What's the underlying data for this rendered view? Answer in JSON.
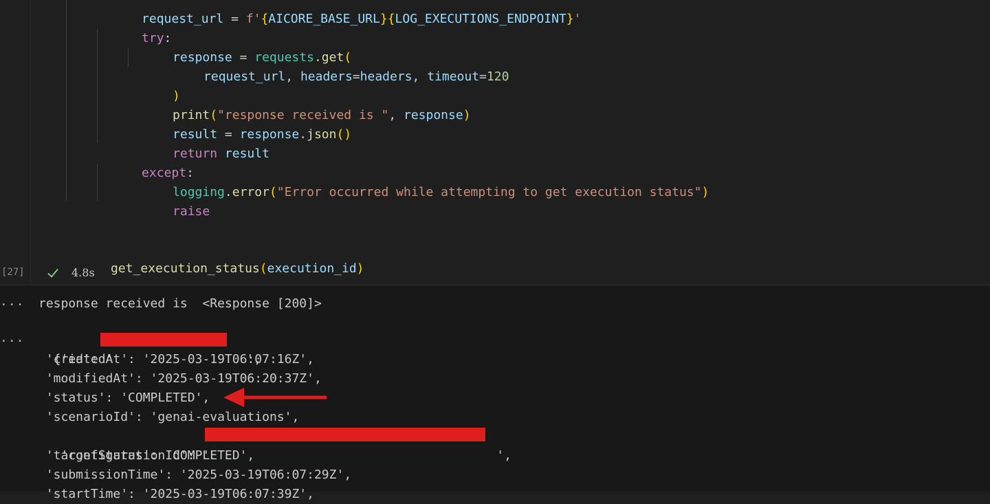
{
  "code": {
    "line_url": {
      "indent": "        ",
      "name": "request_url",
      "op": " = ",
      "fstr_prefix": "f'",
      "brace1": "{",
      "v1": "AICORE_BASE_URL",
      "brace2": "}",
      "brace3": "{",
      "v2": "LOG_EXECUTIONS_ENDPOINT",
      "brace4": "}",
      "tail": "'"
    },
    "line_try": {
      "kw": "try",
      "punct": ":"
    },
    "line_resp": {
      "var": "response",
      "op": " = ",
      "mod": "requests",
      "dot": ".",
      "fn": "get",
      "paren": "("
    },
    "line_args": {
      "a1": "request_url",
      "c1": ", ",
      "a2": "headers",
      "eq1": "=",
      "a3": "headers",
      "c2": ", ",
      "a4": "timeout",
      "eq2": "=",
      "num": "120"
    },
    "line_close": {
      "paren": ")"
    },
    "line_print": {
      "fn": "print",
      "p1": "(",
      "str": "\"response received is \"",
      "c": ", ",
      "var": "response",
      "p2": ")"
    },
    "line_result": {
      "var": "result",
      "op": " = ",
      "obj": "response",
      "dot": ".",
      "fn": "json",
      "p1": "(",
      "p2": ")"
    },
    "line_return": {
      "kw": "return",
      "var": " result"
    },
    "line_except": {
      "kw": "except",
      "punct": ":"
    },
    "line_log": {
      "mod": "logging",
      "dot": ".",
      "fn": "error",
      "p1": "(",
      "str": "\"Error occurred while attempting to get execution status\"",
      "p2": ")"
    },
    "line_raise": {
      "kw": "raise"
    },
    "line_call": {
      "fn": "get_execution_status",
      "p1": "(",
      "var": "execution_id",
      "p2": ")"
    }
  },
  "cell": {
    "execution_count": "[27]",
    "duration": "4.8s"
  },
  "output": {
    "ellipsis": "...",
    "line1": "response received is  <Response [200]>",
    "id_prefix": "{'id': '",
    "id_suffix": "',",
    "created": " 'createdAt': '2025-03-19T06:07:16Z',",
    "modified": " 'modifiedAt': '2025-03-19T06:20:37Z',",
    "status": " 'status': 'COMPLETED',",
    "scenario": " 'scenarioId': 'genai-evaluations',",
    "config_prefix": " 'configurationId': '",
    "config_suffix": "',",
    "target": " 'targetStatus': 'COMPLETED',",
    "submission": " 'submissionTime': '2025-03-19T06:07:29Z',",
    "start_partial": " 'startTime': '2025-03-19T06:07:39Z',"
  },
  "colors": {
    "annotation": "#e01e1e",
    "success": "#89d185"
  }
}
